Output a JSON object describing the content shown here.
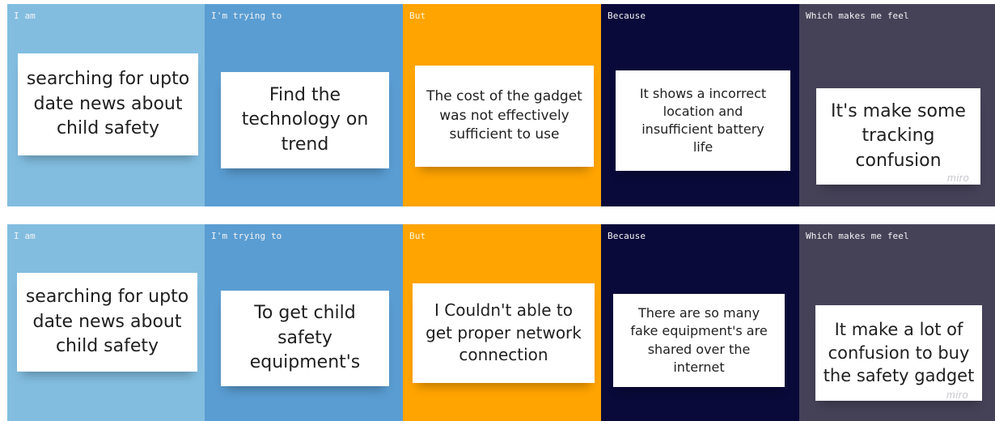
{
  "rows": [
    {
      "columns": [
        {
          "header": "I am",
          "note": "searching for upto date news about child safety"
        },
        {
          "header": "I'm trying to",
          "note": "Find the technology on trend"
        },
        {
          "header": "But",
          "note": "The cost of the gadget was not effectively sufficient to use"
        },
        {
          "header": "Because",
          "note": "It shows a incorrect location and insufficient battery life"
        },
        {
          "header": "Which makes me feel",
          "note": "It's make some tracking confusion"
        }
      ],
      "logo": "miro"
    },
    {
      "columns": [
        {
          "header": "I am",
          "note": "searching for upto date news about child safety"
        },
        {
          "header": "I'm trying to",
          "note": "To get child safety equipment's"
        },
        {
          "header": "But",
          "note": "I Couldn't able to get proper network connection"
        },
        {
          "header": "Because",
          "note": "There are so many fake equipment's are shared over the internet"
        },
        {
          "header": "Which makes me feel",
          "note": "It make a lot of confusion to buy the safety gadget"
        }
      ],
      "logo": "miro"
    }
  ],
  "colors": {
    "i_am": "#82bde0",
    "trying_to": "#5a9dd2",
    "but": "#ffa400",
    "because": "#0a0a3a",
    "feel": "#454258",
    "note": "#ffffff"
  }
}
